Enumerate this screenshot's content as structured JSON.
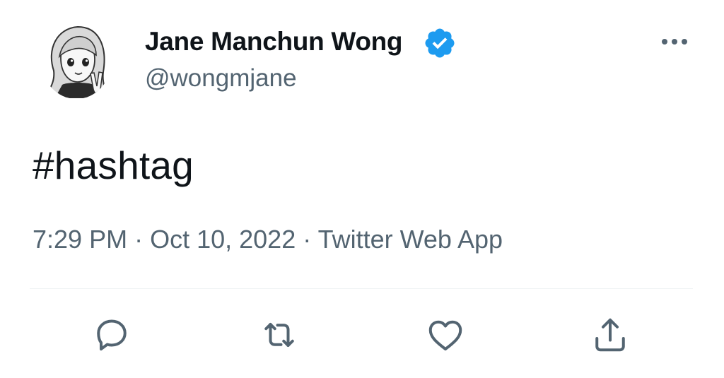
{
  "author": {
    "display_name": "Jane Manchun Wong",
    "handle": "@wongmjane",
    "verified": true,
    "avatar_icon": "cartoon-avatar-icon"
  },
  "tweet": {
    "text": "#hashtag",
    "time": "7:29 PM",
    "date": "Oct 10, 2022",
    "source": "Twitter Web App",
    "separator": " · "
  },
  "actions": [
    {
      "name": "reply",
      "icon": "reply-icon"
    },
    {
      "name": "retweet",
      "icon": "retweet-icon"
    },
    {
      "name": "like",
      "icon": "heart-icon"
    },
    {
      "name": "share",
      "icon": "share-icon"
    }
  ],
  "colors": {
    "text_primary": "#0f1419",
    "text_secondary": "#536471",
    "verified_blue": "#1d9bf0",
    "divider": "#eff3f4"
  }
}
